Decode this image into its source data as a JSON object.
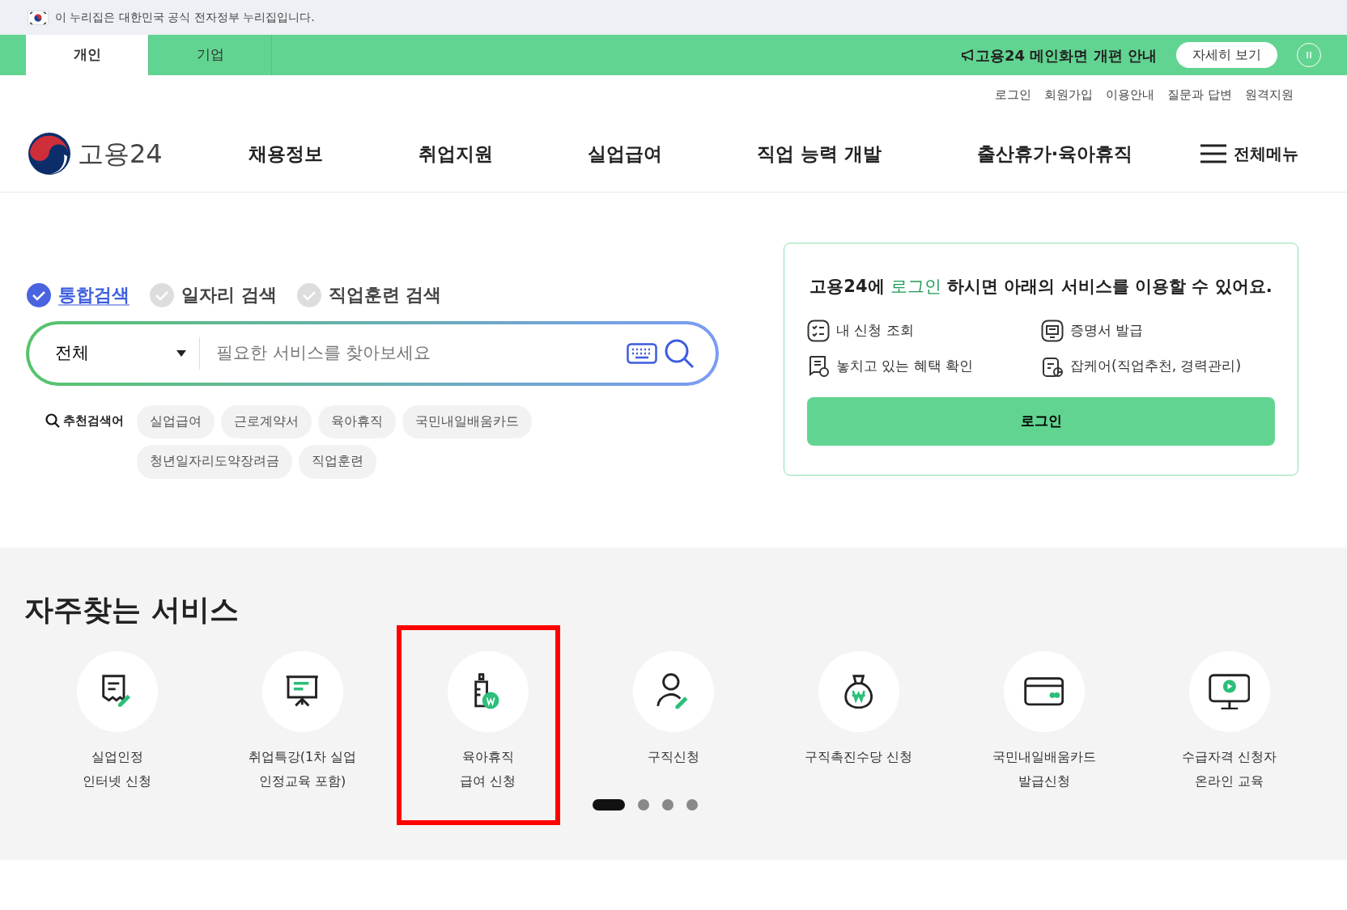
{
  "gov_banner": {
    "text": "이 누리집은 대한민국 공식 전자정부 누리집입니다."
  },
  "top_tabs": [
    {
      "label": "개인",
      "selected": true
    },
    {
      "label": "기업",
      "selected": false
    }
  ],
  "notice": {
    "text": "고용24 메인화면 개편 안내",
    "button": "자세히 보기"
  },
  "util_links": [
    "로그인",
    "회원가입",
    "이용안내",
    "질문과 답변",
    "원격지원"
  ],
  "logo": {
    "text": "고용24"
  },
  "nav": [
    "채용정보",
    "취업지원",
    "실업급여",
    "직업 능력 개발",
    "출산휴가·육아휴직"
  ],
  "all_menu": "전체메뉴",
  "search": {
    "tabs": [
      {
        "label": "통합검색",
        "selected": true
      },
      {
        "label": "일자리 검색",
        "selected": false
      },
      {
        "label": "직업훈련 검색",
        "selected": false
      }
    ],
    "category": "전체",
    "placeholder": "필요한 서비스를 찾아보세요",
    "recommended_label": "추천검색어",
    "keywords": [
      "실업급여",
      "근로계약서",
      "육아휴직",
      "국민내일배움카드",
      "청년일자리도약장려금",
      "직업훈련"
    ]
  },
  "login_card": {
    "message": [
      {
        "text": "고용24에 ",
        "highlight": false
      },
      {
        "text": "로그인",
        "highlight": true
      },
      {
        "text": " 하시면 아래의 서비스를 이용할 수 있어요.",
        "highlight": false
      }
    ],
    "features": [
      "내 신청 조회",
      "증명서 발급",
      "놓치고 있는 혜택 확인",
      "잡케어(직업추천, 경력관리)"
    ],
    "button": "로그인"
  },
  "services": {
    "title": "자주찾는 서비스",
    "items": [
      {
        "lines": [
          "실업인정",
          "인터넷 신청"
        ],
        "highlighted": false
      },
      {
        "lines": [
          "취업특강(1차 실업",
          "인정교육 포함)"
        ],
        "highlighted": false
      },
      {
        "lines": [
          "육아휴직",
          "급여 신청"
        ],
        "highlighted": true
      },
      {
        "lines": [
          "구직신청"
        ],
        "highlighted": false
      },
      {
        "lines": [
          "구직촉진수당 신청"
        ],
        "highlighted": false
      },
      {
        "lines": [
          "국민내일배움카드",
          "발급신청"
        ],
        "highlighted": false
      },
      {
        "lines": [
          "수급자격 신청자",
          "온라인 교육"
        ],
        "highlighted": false
      }
    ],
    "pages": [
      {
        "selected": true
      },
      {
        "selected": false
      },
      {
        "selected": false
      },
      {
        "selected": false
      }
    ]
  }
}
